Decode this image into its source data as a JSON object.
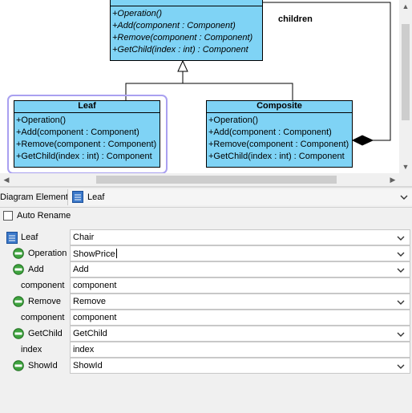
{
  "diagram": {
    "component": {
      "ops": [
        "+Operation()",
        "+Add(component : Component)",
        "+Remove(component : Component)",
        "+GetChild(index : int) : Component"
      ]
    },
    "leaf": {
      "name": "Leaf",
      "ops": [
        "+Operation()",
        "+Add(component : Component)",
        "+Remove(component : Component)",
        "+GetChild(index : int) : Component"
      ]
    },
    "composite": {
      "name": "Composite",
      "ops": [
        "+Operation()",
        "+Add(component : Component)",
        "+Remove(component : Component)",
        "+GetChild(index : int) : Component"
      ]
    },
    "edge_label": "children",
    "colors": {
      "class_fill": "#7fd3f5",
      "selection": "#a9a0f0"
    }
  },
  "element_selector": {
    "label": "Diagram Element",
    "value": "Leaf",
    "icon": "class-icon"
  },
  "auto_rename": {
    "label": "Auto Rename",
    "checked": false
  },
  "properties": [
    {
      "name": "Leaf",
      "value": "Chair",
      "icon": "class-icon",
      "dropdown": true
    },
    {
      "name": "Operation",
      "value": "ShowPrice",
      "icon": "operation-icon",
      "dropdown": true,
      "editing": true
    },
    {
      "name": "Add",
      "value": "Add",
      "icon": "operation-icon",
      "dropdown": true
    },
    {
      "name": "component",
      "value": "component",
      "icon": "",
      "dropdown": false
    },
    {
      "name": "Remove",
      "value": "Remove",
      "icon": "operation-icon",
      "dropdown": true
    },
    {
      "name": "component",
      "value": "component",
      "icon": "",
      "dropdown": false
    },
    {
      "name": "GetChild",
      "value": "GetChild",
      "icon": "operation-icon",
      "dropdown": true
    },
    {
      "name": "index",
      "value": "index",
      "icon": "",
      "dropdown": false
    },
    {
      "name": "ShowId",
      "value": "ShowId",
      "icon": "operation-icon",
      "dropdown": true
    }
  ]
}
